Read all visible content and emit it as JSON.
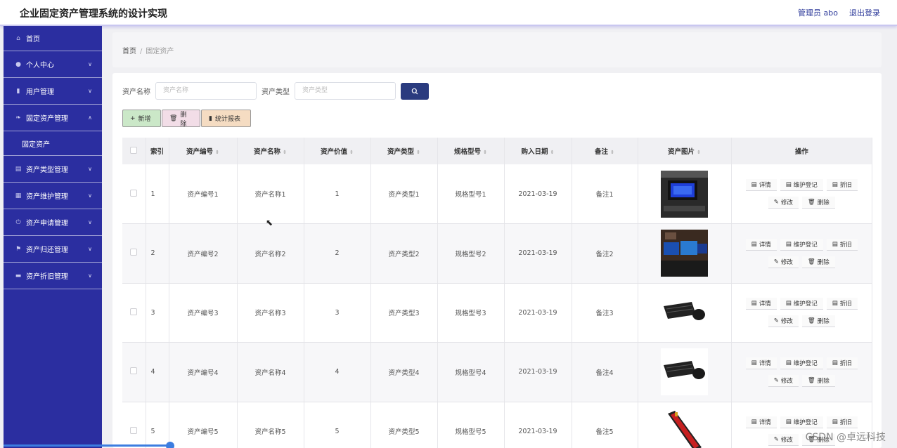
{
  "header": {
    "title": "企业固定资产管理系统的设计实现",
    "user": "管理员 abo",
    "logout": "退出登录"
  },
  "sidebar": {
    "items": [
      {
        "label": "首页",
        "icon": "home-icon"
      },
      {
        "label": "个人中心",
        "icon": "user-icon"
      },
      {
        "label": "用户管理",
        "icon": "chart-icon"
      },
      {
        "label": "固定资产管理",
        "icon": "leaf-icon",
        "expanded": true
      },
      {
        "label": "资产类型管理",
        "icon": "document-icon"
      },
      {
        "label": "资产维护管理",
        "icon": "grid-icon"
      },
      {
        "label": "资产申请管理",
        "icon": "power-icon"
      },
      {
        "label": "资产归还管理",
        "icon": "flag-icon"
      },
      {
        "label": "资产折旧管理",
        "icon": "briefcase-icon"
      }
    ],
    "sub_item": "固定资产"
  },
  "breadcrumb": {
    "home": "首页",
    "sep": "/",
    "current": "固定资产"
  },
  "search": {
    "name_label": "资产名称",
    "name_placeholder": "资产名称",
    "type_label": "资产类型",
    "type_placeholder": "资产类型"
  },
  "actions": {
    "add": "新增",
    "delete": "删除",
    "stats": "统计报表"
  },
  "table": {
    "headers": [
      "索引",
      "资产编号",
      "资产名称",
      "资产价值",
      "资产类型",
      "规格型号",
      "购入日期",
      "备注",
      "资产图片",
      "操作"
    ],
    "rows": [
      {
        "idx": "1",
        "code": "资产编号1",
        "name": "资产名称1",
        "value": "1",
        "type": "资产类型1",
        "model": "规格型号1",
        "date": "2021-03-19",
        "note": "备注1"
      },
      {
        "idx": "2",
        "code": "资产编号2",
        "name": "资产名称2",
        "value": "2",
        "type": "资产类型2",
        "model": "规格型号2",
        "date": "2021-03-19",
        "note": "备注2"
      },
      {
        "idx": "3",
        "code": "资产编号3",
        "name": "资产名称3",
        "value": "3",
        "type": "资产类型3",
        "model": "规格型号3",
        "date": "2021-03-19",
        "note": "备注3"
      },
      {
        "idx": "4",
        "code": "资产编号4",
        "name": "资产名称4",
        "value": "4",
        "type": "资产类型4",
        "model": "规格型号4",
        "date": "2021-03-19",
        "note": "备注4"
      },
      {
        "idx": "5",
        "code": "资产编号5",
        "name": "资产名称5",
        "value": "5",
        "type": "资产类型5",
        "model": "规格型号5",
        "date": "2021-03-19",
        "note": "备注5"
      }
    ],
    "ops": {
      "detail": "详情",
      "maintain": "维护登记",
      "depreciate": "折旧",
      "edit": "修改",
      "remove": "删除"
    }
  },
  "watermark": "CSDN @卓远科技"
}
